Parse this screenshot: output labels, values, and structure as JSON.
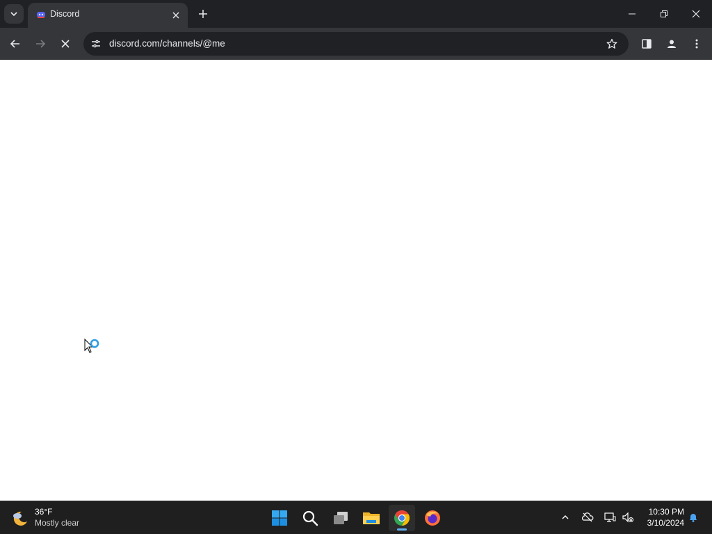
{
  "browser": {
    "tab": {
      "title": "Discord"
    },
    "address_bar": {
      "url": "discord.com/channels/@me"
    }
  },
  "taskbar": {
    "weather": {
      "temp": "36°F",
      "desc": "Mostly clear"
    },
    "pinned_apps": [
      "start-icon",
      "search-icon",
      "task-view-icon",
      "file-explorer-icon",
      "chrome-icon",
      "firefox-icon"
    ],
    "clock": {
      "time": "10:30 PM",
      "date": "3/10/2024"
    }
  },
  "colors": {
    "chrome_dark": "#202124",
    "toolbar": "#35363a",
    "taskbar": "#1f1f1f",
    "accent_blue": "#5fb2f2"
  }
}
